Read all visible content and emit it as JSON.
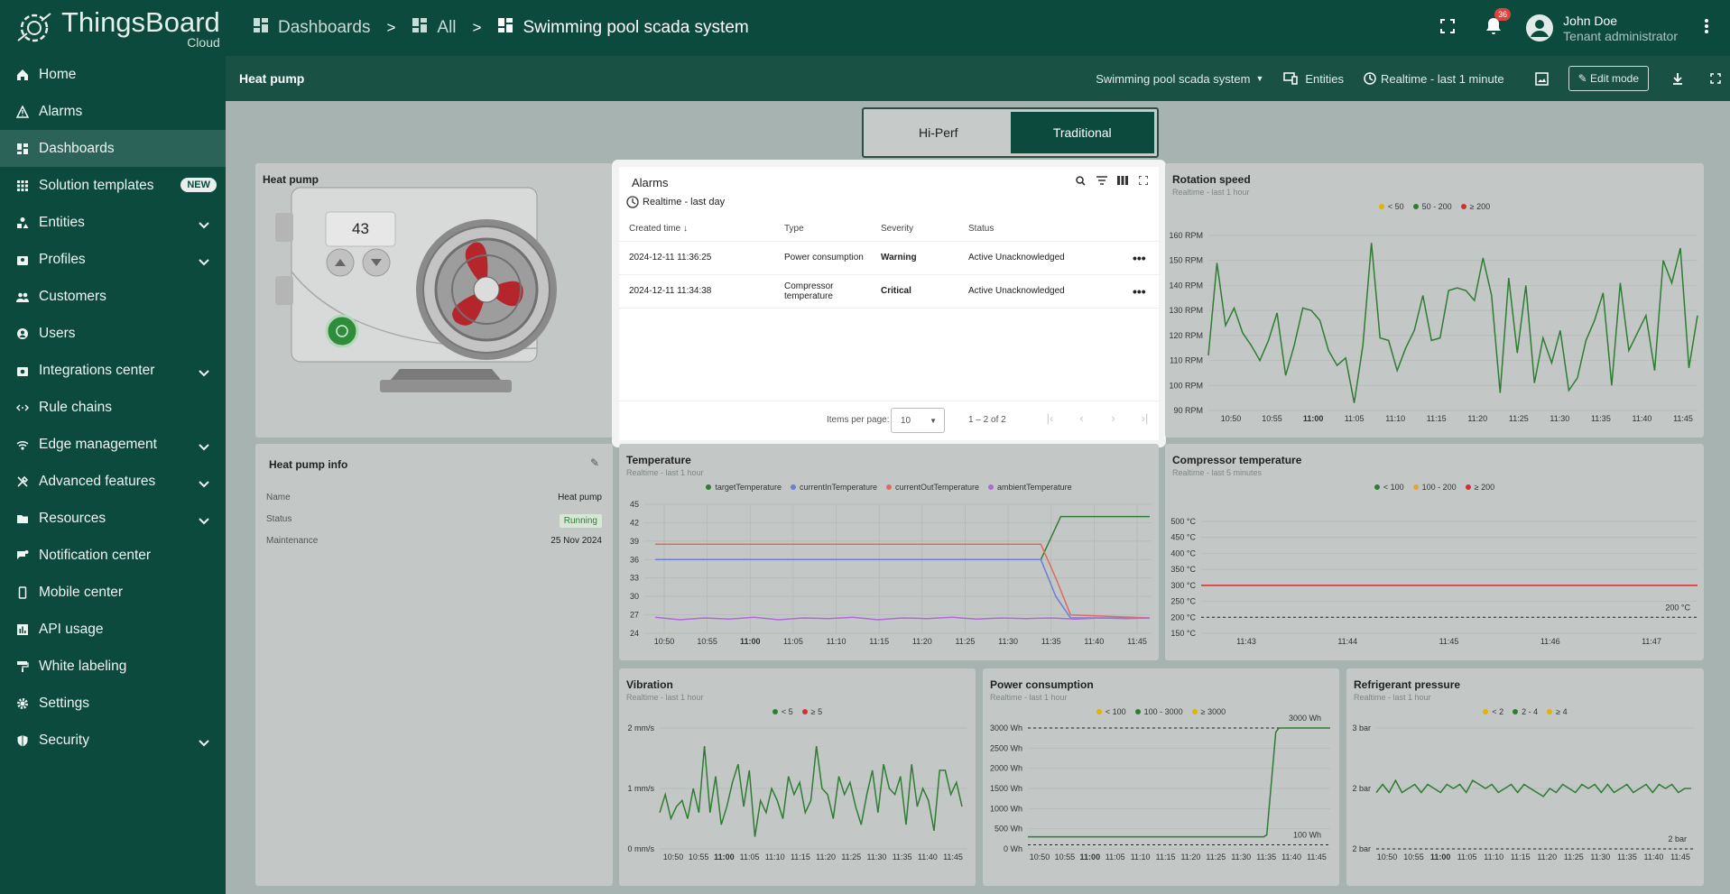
{
  "brand": {
    "name": "ThingsBoard",
    "edition": "Cloud"
  },
  "sidebar": {
    "items": [
      {
        "label": "Home",
        "icon": "home-icon"
      },
      {
        "label": "Alarms",
        "icon": "warning-icon"
      },
      {
        "label": "Dashboards",
        "icon": "dashboard-icon",
        "active": true
      },
      {
        "label": "Solution templates",
        "icon": "apps-icon",
        "badge": "NEW"
      },
      {
        "label": "Entities",
        "icon": "entities-icon",
        "expandable": true
      },
      {
        "label": "Profiles",
        "icon": "profiles-icon",
        "expandable": true
      },
      {
        "label": "Customers",
        "icon": "customers-icon"
      },
      {
        "label": "Users",
        "icon": "user-icon"
      },
      {
        "label": "Integrations center",
        "icon": "integrations-icon",
        "expandable": true
      },
      {
        "label": "Rule chains",
        "icon": "rule-chain-icon"
      },
      {
        "label": "Edge management",
        "icon": "edge-icon",
        "expandable": true
      },
      {
        "label": "Advanced features",
        "icon": "tools-icon",
        "expandable": true
      },
      {
        "label": "Resources",
        "icon": "folder-icon",
        "expandable": true
      },
      {
        "label": "Notification center",
        "icon": "notification-icon"
      },
      {
        "label": "Mobile center",
        "icon": "mobile-icon"
      },
      {
        "label": "API usage",
        "icon": "api-usage-icon"
      },
      {
        "label": "White labeling",
        "icon": "paint-icon"
      },
      {
        "label": "Settings",
        "icon": "gear-icon"
      },
      {
        "label": "Security",
        "icon": "shield-icon",
        "expandable": true
      }
    ]
  },
  "topbar": {
    "breadcrumb": [
      "Dashboards",
      "All",
      "Swimming pool scada system"
    ],
    "separator": ">",
    "notifications": "36",
    "user_name": "John Doe",
    "user_role": "Tenant administrator"
  },
  "subbar": {
    "title": "Heat pump",
    "dashboard_select": "Swimming pool scada system",
    "entities": "Entities",
    "timewindow": "Realtime - last 1 minute",
    "edit_mode": "Edit mode"
  },
  "toggle": {
    "options": [
      "Hi-Perf",
      "Traditional"
    ],
    "selected": "Traditional"
  },
  "heat_pump": {
    "title": "Heat pump",
    "display_value": "43"
  },
  "heat_pump_info": {
    "title": "Heat pump info",
    "rows": [
      {
        "label": "Name",
        "value": "Heat pump"
      },
      {
        "label": "Status",
        "value": "Running"
      },
      {
        "label": "Maintenance",
        "value": "25 Nov 2024"
      }
    ]
  },
  "alarms": {
    "title": "Alarms",
    "timewindow": "Realtime - last day",
    "columns": [
      "Created time",
      "Type",
      "Severity",
      "Status"
    ],
    "rows": [
      {
        "created": "2024-12-11 11:36:25",
        "type": "Power consumption",
        "severity": "Warning",
        "status": "Active Unacknowledged"
      },
      {
        "created": "2024-12-11 11:34:38",
        "type": "Compressor temperature",
        "severity": "Critical",
        "status": "Active Unacknowledged"
      }
    ],
    "items_per_page_label": "Items per page:",
    "items_per_page": "10",
    "range": "1 – 2 of 2"
  },
  "colors": {
    "green": "#2e7d32",
    "red": "#d32f2f",
    "yellow": "#e0b400",
    "blue": "#6b7fd6",
    "purple": "#b06ad6",
    "accent": "#0d4a3e"
  },
  "chart_data": [
    {
      "id": "rotation",
      "type": "line",
      "title": "Rotation speed",
      "subtitle": "Realtime - last 1 hour",
      "legend": [
        "< 50",
        "50 - 200",
        "≥ 200"
      ],
      "y_ticks": [
        "160 RPM",
        "150 RPM",
        "140 RPM",
        "130 RPM",
        "120 RPM",
        "110 RPM",
        "100 RPM",
        "90 RPM"
      ],
      "x_ticks": [
        "10:50",
        "10:55",
        "11:00",
        "11:05",
        "11:10",
        "11:15",
        "11:20",
        "11:25",
        "11:30",
        "11:35",
        "11:40",
        "11:45"
      ],
      "ylim": [
        90,
        165
      ],
      "values": [
        112,
        149,
        124,
        131,
        121,
        116,
        110,
        118,
        129,
        104,
        116,
        131,
        130,
        126,
        114,
        108,
        111,
        93,
        116,
        157,
        119,
        118,
        106,
        115,
        122,
        136,
        118,
        119,
        138,
        139,
        138,
        134,
        151,
        136,
        97,
        143,
        113,
        140,
        101,
        119,
        109,
        122,
        98,
        103,
        118,
        126,
        137,
        100,
        141,
        114,
        121,
        128,
        106,
        150,
        141,
        155,
        107,
        128
      ]
    },
    {
      "id": "temperature",
      "type": "line",
      "title": "Temperature",
      "subtitle": "Realtime - last 1 hour",
      "legend": [
        "targetTemperature",
        "currentInTemperature",
        "currentOutTemperature",
        "ambientTemperature"
      ],
      "y_ticks": [
        "45",
        "42",
        "39",
        "36",
        "33",
        "30",
        "27",
        "24"
      ],
      "x_ticks": [
        "10:50",
        "10:55",
        "11:00",
        "11:05",
        "11:10",
        "11:15",
        "11:20",
        "11:25",
        "11:30",
        "11:35",
        "11:40",
        "11:45"
      ],
      "ylim": [
        24,
        45
      ],
      "series": [
        {
          "name": "targetTemperature",
          "x": [
            0,
            0.78,
            0.82,
            1
          ],
          "y": [
            36,
            36,
            43,
            43
          ]
        },
        {
          "name": "currentInTemperature",
          "x": [
            0,
            0.78,
            0.81,
            0.84,
            1
          ],
          "y": [
            36,
            36,
            30,
            26.5,
            26.5
          ]
        },
        {
          "name": "currentOutTemperature",
          "x": [
            0,
            0.78,
            0.81,
            0.84,
            1
          ],
          "y": [
            38.5,
            38.5,
            33,
            27,
            26.5
          ]
        },
        {
          "name": "ambientTemperature",
          "x": [
            0,
            0.05,
            0.1,
            0.15,
            0.2,
            0.25,
            0.3,
            0.35,
            0.4,
            0.45,
            0.5,
            0.55,
            0.6,
            0.65,
            0.7,
            0.75,
            0.8,
            0.85,
            0.9,
            0.95,
            1
          ],
          "y": [
            26.6,
            26.2,
            26.5,
            26.3,
            26.6,
            26.2,
            26.5,
            26.4,
            26.6,
            26.2,
            26.5,
            26.4,
            26.6,
            26.3,
            26.5,
            26.4,
            26.5,
            26.3,
            26.5,
            26.4,
            26.5
          ]
        }
      ]
    },
    {
      "id": "compressor",
      "type": "line",
      "title": "Compressor temperature",
      "subtitle": "Realtime - last 5 minutes",
      "legend": [
        "< 100",
        "100 - 200",
        "≥ 200"
      ],
      "y_ticks": [
        "500 °C",
        "450 °C",
        "400 °C",
        "350 °C",
        "300 °C",
        "250 °C",
        "200 °C",
        "150 °C"
      ],
      "x_ticks": [
        "11:43",
        "11:44",
        "11:45",
        "11:46",
        "11:47"
      ],
      "ylim": [
        150,
        500
      ],
      "values": [
        300,
        300
      ],
      "threshold": 200,
      "threshold_label": "200 °C"
    },
    {
      "id": "vibration",
      "type": "line",
      "title": "Vibration",
      "subtitle": "Realtime - last 1 hour",
      "legend": [
        "< 5",
        "≥ 5"
      ],
      "y_ticks": [
        "2 mm/s",
        "1 mm/s",
        "0 mm/s"
      ],
      "x_ticks": [
        "10:50",
        "10:55",
        "11:00",
        "11:05",
        "11:10",
        "11:15",
        "11:20",
        "11:25",
        "11:30",
        "11:35",
        "11:40",
        "11:45"
      ],
      "ylim": [
        0,
        2
      ],
      "values": [
        0.6,
        0.9,
        0.5,
        0.7,
        0.8,
        0.5,
        1.0,
        0.6,
        1.7,
        0.6,
        1.2,
        0.4,
        0.7,
        1.1,
        1.4,
        0.7,
        1.3,
        0.2,
        0.8,
        0.6,
        1.0,
        0.8,
        0.5,
        1.2,
        0.9,
        1.1,
        0.6,
        0.8,
        1.7,
        1.0,
        0.9,
        0.5,
        1.2,
        0.9,
        1.1,
        0.7,
        0.4,
        0.9,
        1.3,
        0.6,
        1.4,
        1.0,
        0.9,
        1.2,
        0.4,
        1.4,
        0.7,
        1.0,
        0.8,
        0.3,
        1.3,
        1.3,
        0.9,
        1.1,
        0.7
      ]
    },
    {
      "id": "power",
      "type": "line",
      "title": "Power consumption",
      "subtitle": "Realtime - last 1 hour",
      "legend": [
        "< 100",
        "100 - 3000",
        "≥ 3000"
      ],
      "y_ticks": [
        "3000 Wh",
        "2500 Wh",
        "2000 Wh",
        "1500 Wh",
        "1000 Wh",
        "500 Wh",
        "0 Wh"
      ],
      "x_ticks": [
        "10:50",
        "10:55",
        "11:00",
        "11:05",
        "11:10",
        "11:15",
        "11:20",
        "11:25",
        "11:30",
        "11:35",
        "11:40",
        "11:45"
      ],
      "ylim": [
        0,
        3000
      ],
      "series": [
        {
          "name": "",
          "x": [
            0,
            0.78,
            0.79,
            0.82,
            0.83,
            1
          ],
          "y": [
            300,
            300,
            350,
            2900,
            3000,
            3000
          ]
        }
      ],
      "threshold_high": 3000,
      "threshold_high_label": "3000 Wh",
      "threshold_low": 100,
      "threshold_low_label": "100 Wh"
    },
    {
      "id": "refrigerant",
      "type": "line",
      "title": "Refrigerant pressure",
      "subtitle": "Realtime - last 1 hour",
      "legend": [
        "< 2",
        "2 - 4",
        "≥ 4"
      ],
      "y_ticks": [
        "3 bar",
        "2 bar",
        "2 bar"
      ],
      "x_ticks": [
        "10:50",
        "10:55",
        "11:00",
        "11:05",
        "11:10",
        "11:15",
        "11:20",
        "11:25",
        "11:30",
        "11:35",
        "11:40",
        "11:45"
      ],
      "ylim": [
        1.5,
        3
      ],
      "values": [
        2.2,
        2.3,
        2.2,
        2.35,
        2.2,
        2.25,
        2.3,
        2.2,
        2.3,
        2.25,
        2.2,
        2.3,
        2.25,
        2.3,
        2.2,
        2.35,
        2.3,
        2.25,
        2.3,
        2.2,
        2.25,
        2.3,
        2.2,
        2.3,
        2.25,
        2.2,
        2.15,
        2.25,
        2.2,
        2.3,
        2.25,
        2.2,
        2.3,
        2.25,
        2.3,
        2.2,
        2.3,
        2.2,
        2.25,
        2.3,
        2.2,
        2.25,
        2.3,
        2.2,
        2.3,
        2.25,
        2.3,
        2.2,
        2.25,
        2.25
      ],
      "threshold": 1.5,
      "threshold_label": "2 bar"
    }
  ]
}
